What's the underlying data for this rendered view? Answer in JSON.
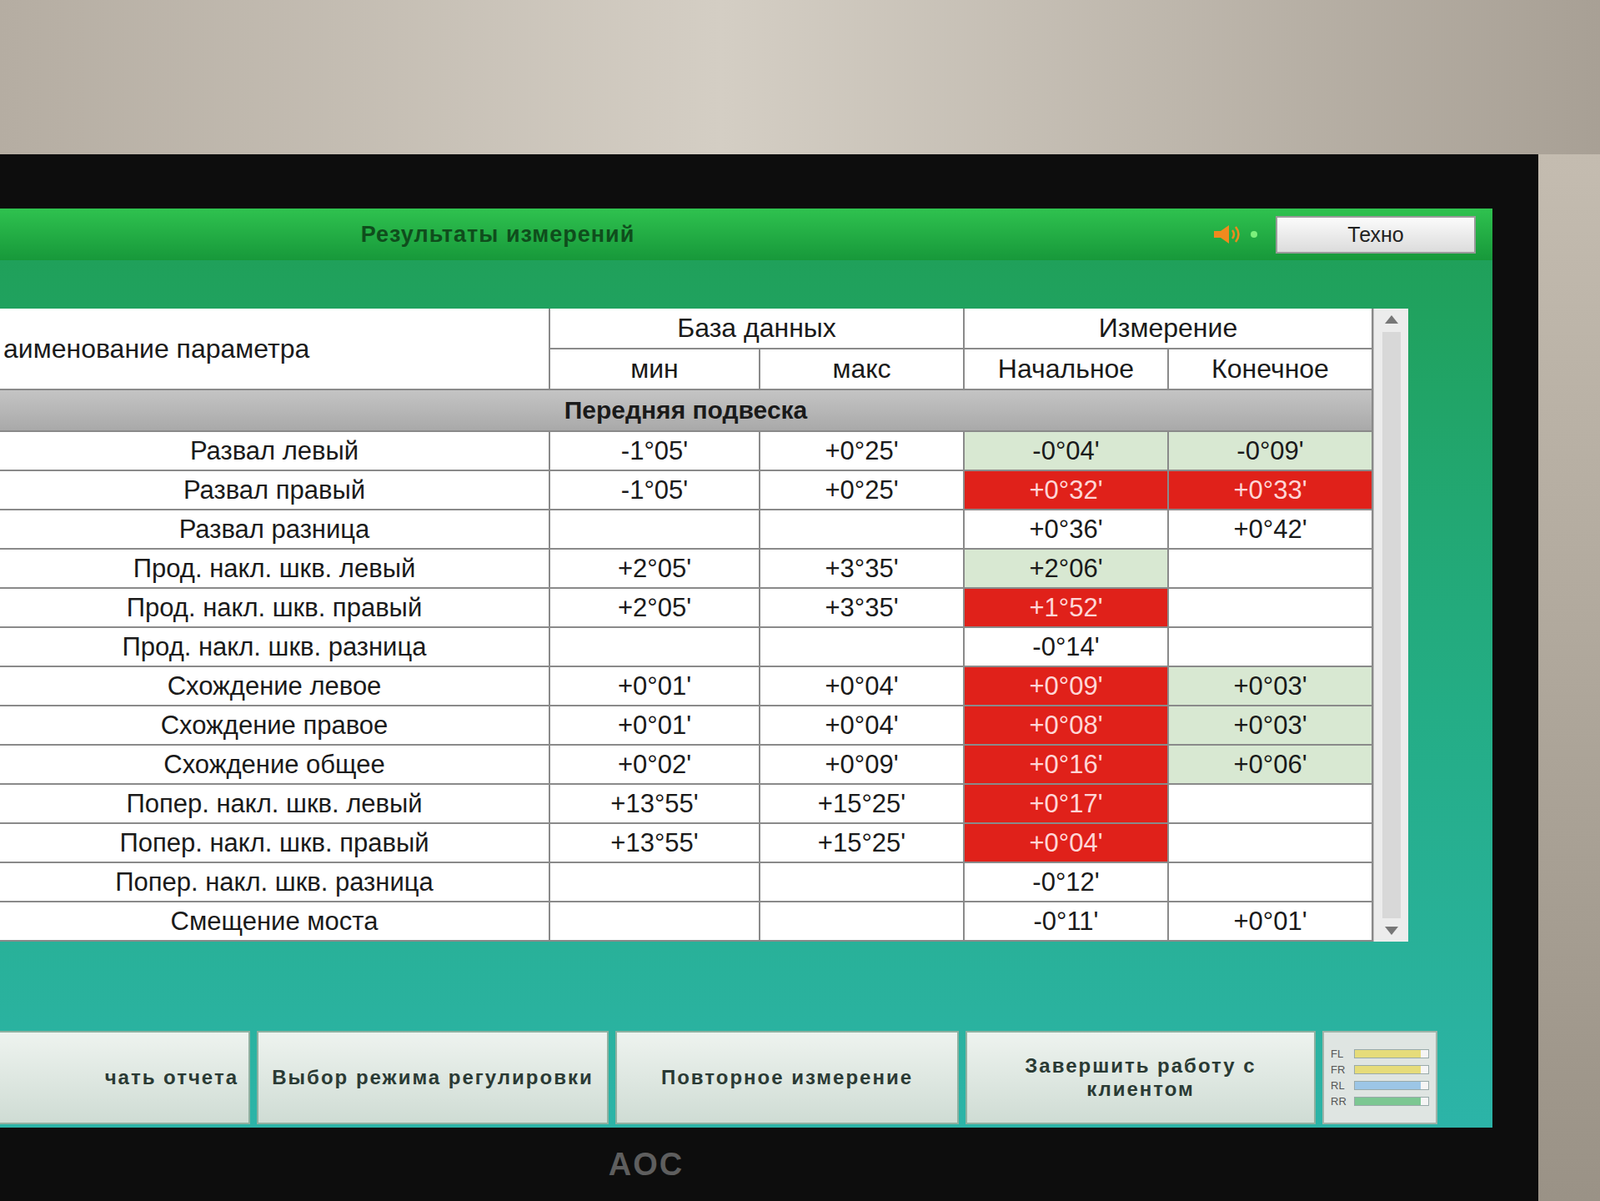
{
  "window": {
    "title": "Результаты измерений",
    "mode_button": "Техно"
  },
  "table": {
    "columns": {
      "name": "аименование параметра",
      "database": "База данных",
      "min": "мин",
      "max": "макс",
      "measurement": "Измерение",
      "initial": "Начальное",
      "final": "Конечное"
    },
    "section": "Передняя подвеска",
    "rows": [
      {
        "name": "Развал левый",
        "min": "-1°05'",
        "max": "+0°25'",
        "initial": {
          "value": "-0°04'",
          "kind": "ok"
        },
        "final": {
          "value": "-0°09'",
          "kind": "ok"
        }
      },
      {
        "name": "Развал правый",
        "min": "-1°05'",
        "max": "+0°25'",
        "initial": {
          "value": "+0°32'",
          "kind": "bad"
        },
        "final": {
          "value": "+0°33'",
          "kind": "bad"
        }
      },
      {
        "name": "Развал разница",
        "min": "",
        "max": "",
        "initial": {
          "value": "+0°36'",
          "kind": "plain"
        },
        "final": {
          "value": "+0°42'",
          "kind": "plain"
        }
      },
      {
        "name": "Прод. накл. шкв. левый",
        "min": "+2°05'",
        "max": "+3°35'",
        "initial": {
          "value": "+2°06'",
          "kind": "ok"
        },
        "final": {
          "value": "",
          "kind": "plain"
        }
      },
      {
        "name": "Прод. накл. шкв. правый",
        "min": "+2°05'",
        "max": "+3°35'",
        "initial": {
          "value": "+1°52'",
          "kind": "bad"
        },
        "final": {
          "value": "",
          "kind": "plain"
        }
      },
      {
        "name": "Прод. накл. шкв. разница",
        "min": "",
        "max": "",
        "initial": {
          "value": "-0°14'",
          "kind": "plain"
        },
        "final": {
          "value": "",
          "kind": "plain"
        }
      },
      {
        "name": "Схождение левое",
        "min": "+0°01'",
        "max": "+0°04'",
        "initial": {
          "value": "+0°09'",
          "kind": "bad"
        },
        "final": {
          "value": "+0°03'",
          "kind": "ok"
        }
      },
      {
        "name": "Схождение правое",
        "min": "+0°01'",
        "max": "+0°04'",
        "initial": {
          "value": "+0°08'",
          "kind": "bad"
        },
        "final": {
          "value": "+0°03'",
          "kind": "ok"
        }
      },
      {
        "name": "Схождение общее",
        "min": "+0°02'",
        "max": "+0°09'",
        "initial": {
          "value": "+0°16'",
          "kind": "bad"
        },
        "final": {
          "value": "+0°06'",
          "kind": "ok"
        }
      },
      {
        "name": "Попер. накл. шкв. левый",
        "min": "+13°55'",
        "max": "+15°25'",
        "initial": {
          "value": "+0°17'",
          "kind": "bad"
        },
        "final": {
          "value": "",
          "kind": "plain"
        }
      },
      {
        "name": "Попер. накл. шкв. правый",
        "min": "+13°55'",
        "max": "+15°25'",
        "initial": {
          "value": "+0°04'",
          "kind": "bad"
        },
        "final": {
          "value": "",
          "kind": "plain"
        }
      },
      {
        "name": "Попер. накл. шкв. разница",
        "min": "",
        "max": "",
        "initial": {
          "value": "-0°12'",
          "kind": "plain"
        },
        "final": {
          "value": "",
          "kind": "plain"
        }
      },
      {
        "name": "Смещение моста",
        "min": "",
        "max": "",
        "initial": {
          "value": "-0°11'",
          "kind": "plain"
        },
        "final": {
          "value": "+0°01'",
          "kind": "plain"
        }
      }
    ]
  },
  "buttons": [
    "чать отчета",
    "Выбор режима регулировки",
    "Повторное измерение",
    "Завершить работу с клиентом"
  ],
  "wheels": [
    {
      "label": "FL",
      "level": 0.9,
      "color": "#e6dc7a"
    },
    {
      "label": "FR",
      "level": 0.9,
      "color": "#e6dc7a"
    },
    {
      "label": "RL",
      "level": 0.9,
      "color": "#9cc6e6"
    },
    {
      "label": "RR",
      "level": 0.9,
      "color": "#7cc792"
    }
  ],
  "logo": "AOC"
}
